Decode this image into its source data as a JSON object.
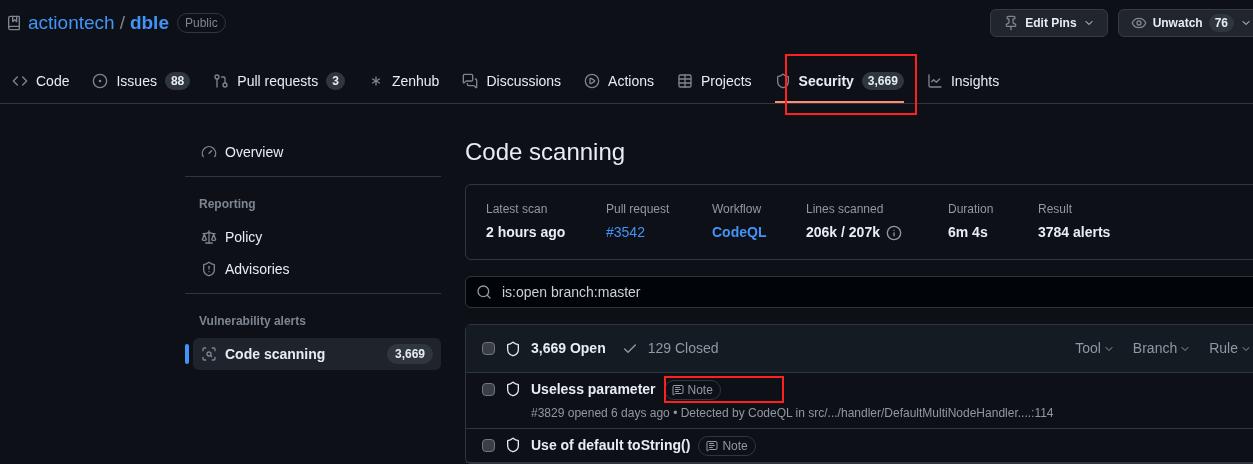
{
  "repo": {
    "owner": "actiontech",
    "separator": "/",
    "name": "dble",
    "visibility": "Public"
  },
  "header_buttons": [
    {
      "kind": "pin",
      "label": "Edit Pins"
    },
    {
      "kind": "watch",
      "label": "Unwatch",
      "count": "76"
    }
  ],
  "tabs": [
    {
      "label": "Code",
      "selected": false
    },
    {
      "label": "Issues",
      "count": "88",
      "selected": false
    },
    {
      "label": "Pull requests",
      "count": "3",
      "selected": false
    },
    {
      "label": "Zenhub",
      "selected": false
    },
    {
      "label": "Discussions",
      "selected": false
    },
    {
      "label": "Actions",
      "selected": false
    },
    {
      "label": "Projects",
      "selected": false
    },
    {
      "label": "Security",
      "count": "3,669",
      "selected": true
    },
    {
      "label": "Insights",
      "selected": false
    }
  ],
  "sidebar": {
    "sections": [
      {
        "items": [
          {
            "label": "Overview",
            "selected": false
          }
        ]
      },
      {
        "heading": "Reporting",
        "items": [
          {
            "label": "Policy",
            "selected": false
          },
          {
            "label": "Advisories",
            "selected": false
          }
        ]
      },
      {
        "heading": "Vulnerability alerts",
        "items": [
          {
            "label": "Code scanning",
            "count": "3,669",
            "selected": true
          }
        ]
      }
    ]
  },
  "page_title": "Code scanning",
  "scan_summary": [
    {
      "label": "Latest scan",
      "value": "2 hours ago",
      "kind": "text"
    },
    {
      "label": "Pull request",
      "value": "#3542",
      "kind": "link"
    },
    {
      "label": "Workflow",
      "value": "CodeQL",
      "kind": "link-bold"
    },
    {
      "label": "Lines scanned",
      "value": "206k / 207k",
      "kind": "info"
    },
    {
      "label": "Duration",
      "value": "6m 4s",
      "kind": "text"
    },
    {
      "label": "Result",
      "value": "3784 alerts",
      "kind": "text"
    }
  ],
  "search": {
    "value": "is:open branch:master"
  },
  "alerts_header": {
    "checked": false,
    "open": "3,669 Open",
    "closed": "129 Closed",
    "filters": [
      "Tool",
      "Branch",
      "Rule"
    ]
  },
  "alerts": [
    {
      "checked": false,
      "title": "Useless parameter",
      "badge": "Note",
      "meta": "#3829 opened 6 days ago • Detected by CodeQL in src/.../handler/DefaultMultiNodeHandler....:114"
    },
    {
      "checked": false,
      "title": "Use of default toString()",
      "badge": "Note"
    }
  ]
}
